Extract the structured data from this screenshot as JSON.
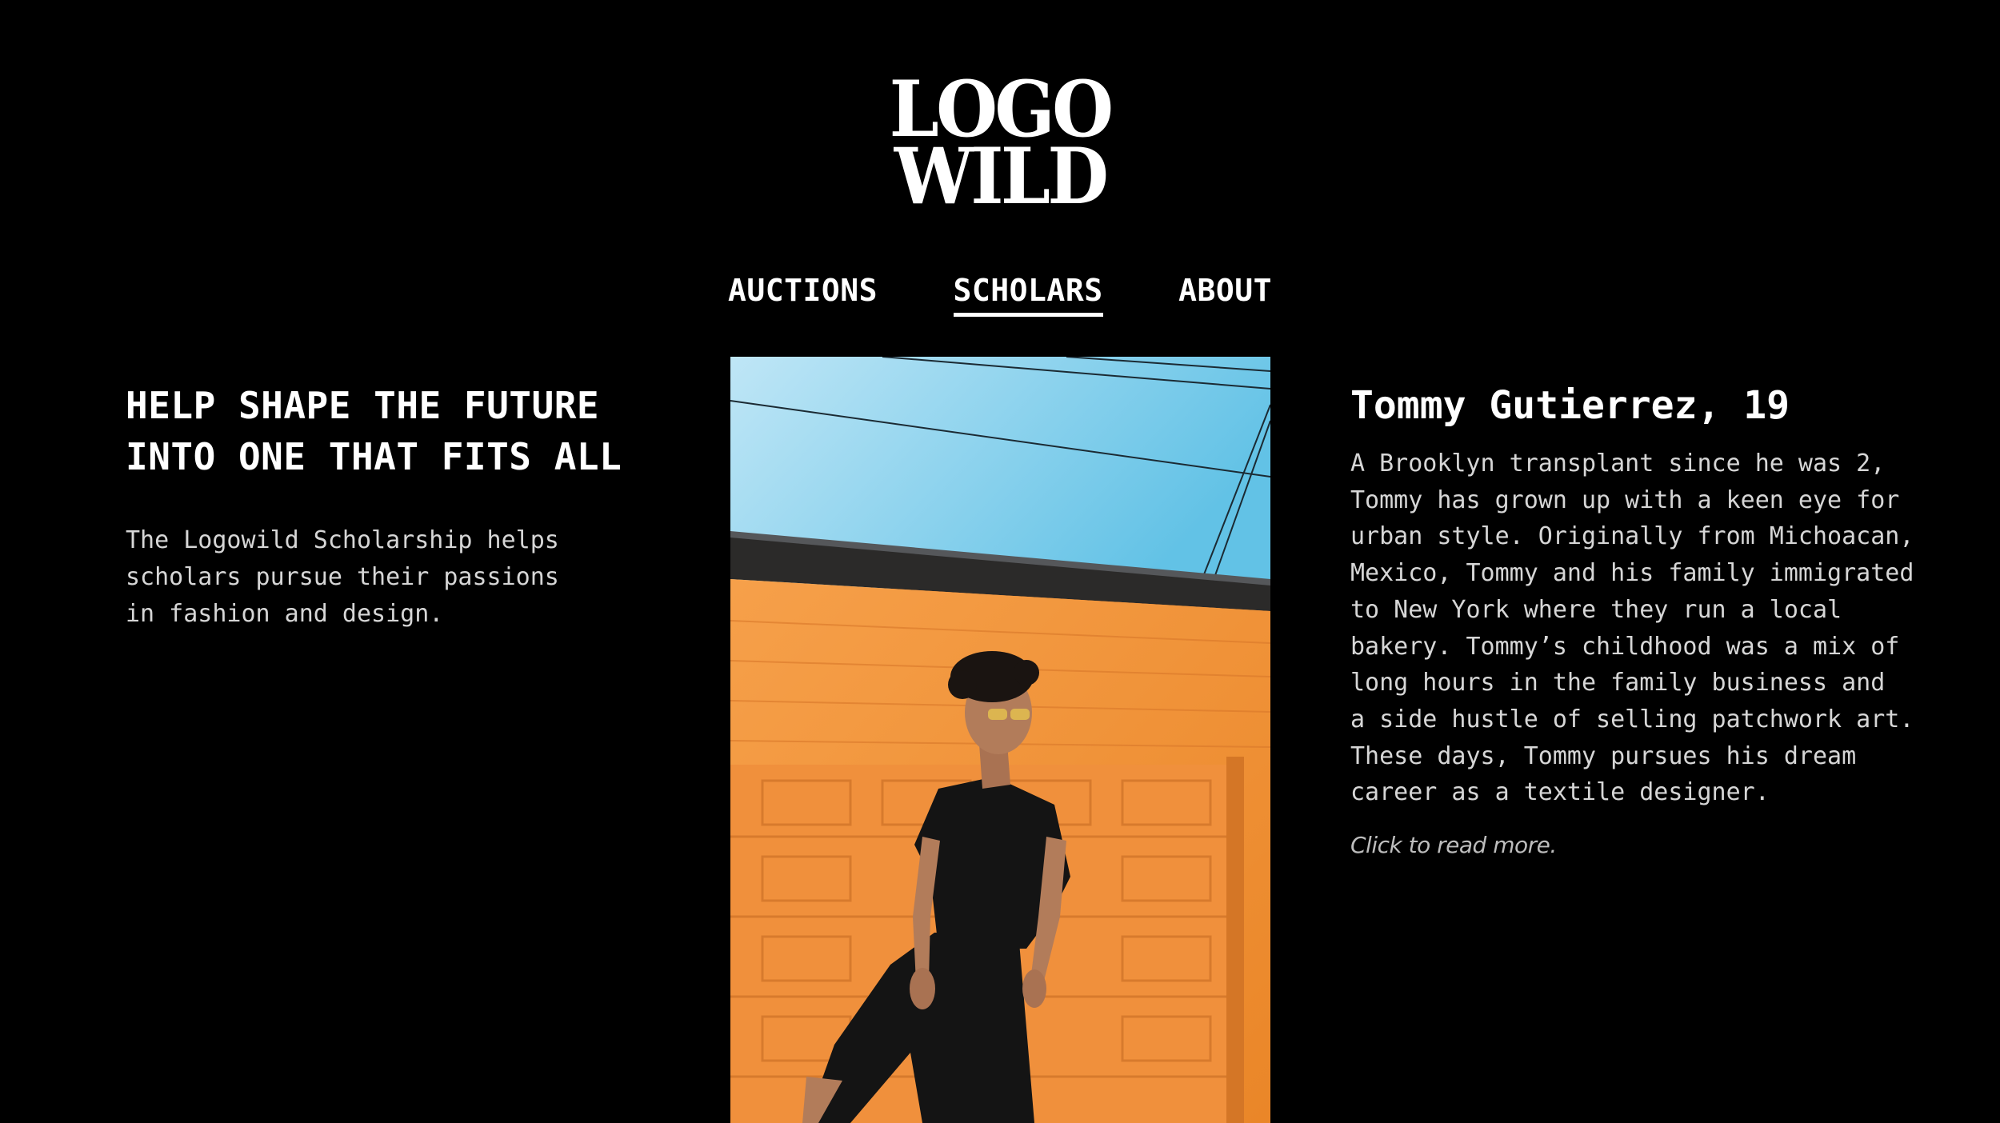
{
  "logo": {
    "line1": "LOGO",
    "line2": "WILD"
  },
  "nav": {
    "items": [
      {
        "label": "AUCTIONS"
      },
      {
        "label": "SCHOLARS"
      },
      {
        "label": "ABOUT"
      }
    ],
    "active": "SCHOLARS"
  },
  "hero": {
    "headline_line1": "HELP SHAPE THE FUTURE",
    "headline_line2": "INTO ONE THAT FITS ALL",
    "intro_lines": [
      "The Logowild Scholarship helps",
      "scholars pursue their passions",
      "in fashion and design."
    ]
  },
  "scholar": {
    "name": "Tommy Gutierrez, 19",
    "bio_lines": [
      "A Brooklyn transplant since he was 2,",
      "Tommy has grown up with a keen eye for",
      "urban style. Originally from Michoacan,",
      "Mexico, Tommy and his family immigrated",
      "to New York where they run a local",
      "bakery. Tommy’s childhood was a mix of",
      "long hours in the family business and",
      "a side hustle of selling patchwork art.",
      "These days, Tommy pursues his dream",
      "career as a textile designer."
    ],
    "read_more": "Click to read more."
  },
  "colors": {
    "background": "#000000",
    "text": "#ffffff",
    "body_text": "#d6d6d6",
    "sky": "#7fcbea",
    "wall": "#f2923a"
  }
}
